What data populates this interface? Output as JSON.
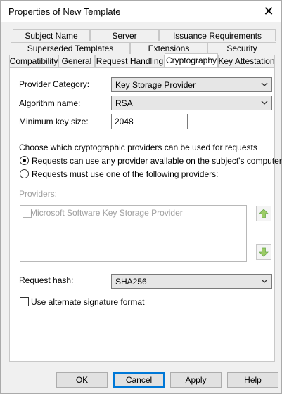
{
  "window": {
    "title": "Properties of New Template"
  },
  "tabs": {
    "row1": [
      "Subject Name",
      "Server",
      "Issuance Requirements"
    ],
    "row2": [
      "Superseded Templates",
      "Extensions",
      "Security"
    ],
    "row3": [
      "Compatibility",
      "General",
      "Request Handling",
      "Cryptography",
      "Key Attestation"
    ],
    "active": "Cryptography"
  },
  "form": {
    "provider_category_label": "Provider Category:",
    "provider_category_value": "Key Storage Provider",
    "algorithm_label": "Algorithm name:",
    "algorithm_value": "RSA",
    "min_key_label": "Minimum key size:",
    "min_key_value": "2048",
    "choose_text": "Choose which cryptographic providers can be used for requests",
    "radio_any": "Requests can use any provider available on the subject's computer",
    "radio_must": "Requests must use one of the following providers:",
    "providers_label": "Providers:",
    "providers_list": [
      "Microsoft Software Key Storage Provider"
    ],
    "request_hash_label": "Request hash:",
    "request_hash_value": "SHA256",
    "alt_signature_label": "Use alternate signature format"
  },
  "buttons": {
    "ok": "OK",
    "cancel": "Cancel",
    "apply": "Apply",
    "help": "Help"
  },
  "colors": {
    "accent": "#0078d7",
    "arrow_green": "#4caf50"
  }
}
